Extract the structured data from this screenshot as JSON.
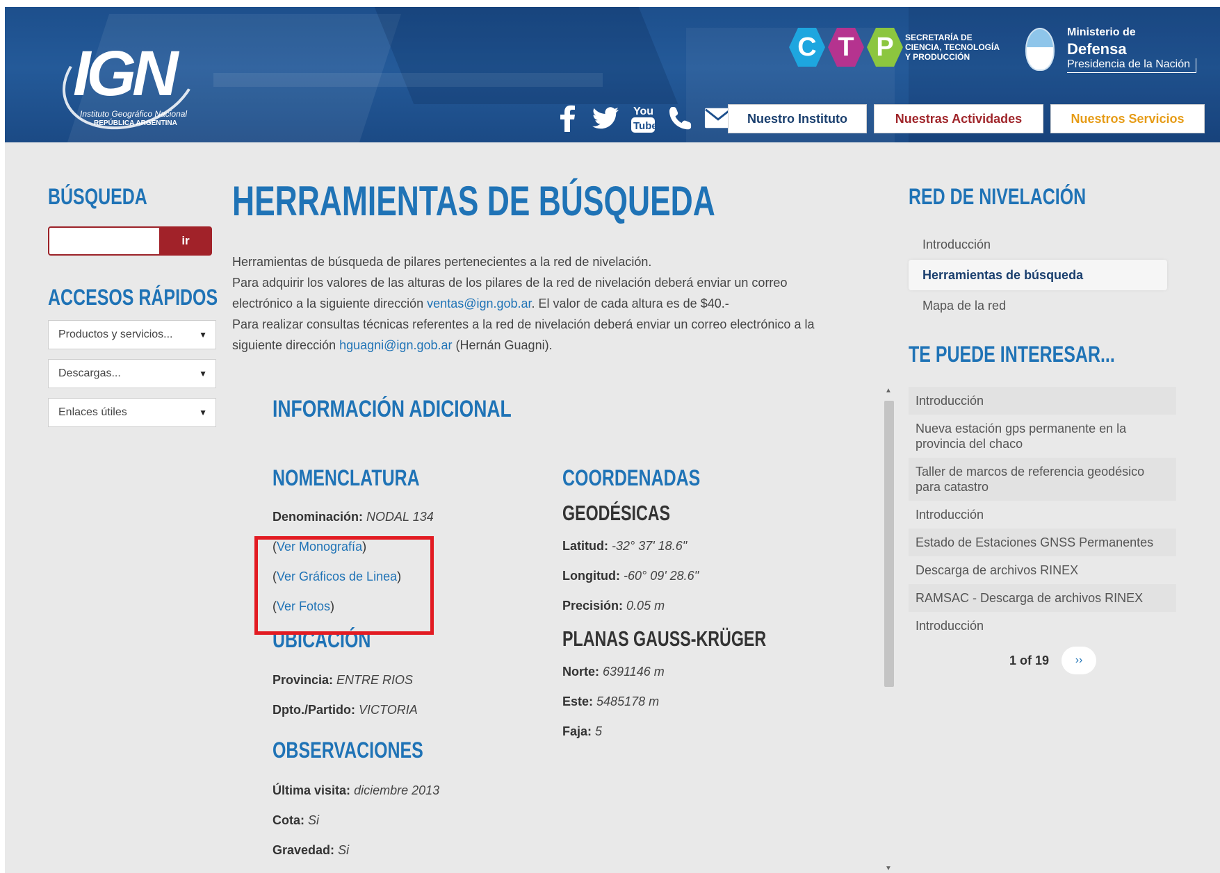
{
  "header": {
    "logo": {
      "word": "IGN",
      "sub1": "Instituto Geográfico Nacional",
      "sub2": "REPÚBLICA ARGENTINA"
    },
    "ctp": {
      "letters": [
        "C",
        "T",
        "P"
      ],
      "text_lines": [
        "SECRETARÍA DE",
        "CIENCIA, TECNOLOGÍA",
        "Y PRODUCCIÓN"
      ]
    },
    "ministerio": {
      "line1": "Ministerio de",
      "line2": "Defensa",
      "line3": "Presidencia de la Nación"
    },
    "social_icons": [
      "facebook-icon",
      "twitter-icon",
      "youtube-icon",
      "phone-icon",
      "mail-icon"
    ],
    "nav": {
      "instituto": "Nuestro Instituto",
      "actividades": "Nuestras Actividades",
      "servicios": "Nuestros Servicios"
    }
  },
  "left": {
    "busqueda_title": "BÚSQUEDA",
    "search_placeholder": "",
    "search_button": "ir",
    "accesos_title": "ACCESOS RÁPIDOS",
    "dropdowns": [
      "Productos y servicios...",
      "Descargas...",
      "Enlaces útiles"
    ]
  },
  "main": {
    "title": "HERRAMIENTAS DE BÚSQUEDA",
    "intro": {
      "line1": "Herramientas de búsqueda de pilares pertenecientes a la red de nivelación.",
      "line2": "Para adquirir los valores de las alturas de los pilares de la red de nivelación deberá enviar un correo",
      "line3_pre": "electrónico a la siguiente dirección ",
      "line3_link": "ventas@ign.gob.ar",
      "line3_post": ". El valor de cada altura es de $40.-",
      "line4": "Para realizar consultas técnicas referentes a la red de nivelación deberá enviar un correo electrónico a la",
      "line5_pre": "siguiente dirección ",
      "line5_link": "hguagni@ign.gob.ar",
      "line5_post": " (Hernán Guagni)."
    },
    "info_title": "INFORMACIÓN ADICIONAL",
    "nomenclatura": {
      "title": "NOMENCLATURA",
      "denominacion_label": "Denominación:",
      "denominacion_value": "NODAL 134",
      "links": [
        "Ver Monografía",
        "Ver Gráficos de Linea",
        "Ver Fotos"
      ]
    },
    "ubicacion": {
      "title": "UBICACIÓN",
      "provincia_label": "Provincia:",
      "provincia_value": "ENTRE RIOS",
      "dpto_label": "Dpto./Partido:",
      "dpto_value": "VICTORIA"
    },
    "observaciones": {
      "title": "OBSERVACIONES",
      "visita_label": "Última visita:",
      "visita_value": "diciembre 2013",
      "cota_label": "Cota:",
      "cota_value": "Si",
      "gravedad_label": "Gravedad:",
      "gravedad_value": "Si"
    },
    "coordenadas": {
      "title": "COORDENADAS",
      "geodesicas_title": "GEODÉSICAS",
      "latitud_label": "Latitud:",
      "latitud_value": "-32° 37' 18.6\"",
      "longitud_label": "Longitud:",
      "longitud_value": "-60° 09' 28.6\"",
      "precision_label": "Precisión:",
      "precision_value": "0.05 m",
      "planas_title": "PLANAS GAUSS-KRÜGER",
      "norte_label": "Norte:",
      "norte_value": "6391146 m",
      "este_label": "Este:",
      "este_value": "5485178 m",
      "faja_label": "Faja:",
      "faja_value": "5"
    }
  },
  "right": {
    "red_title": "RED DE NIVELACIÓN",
    "menu": [
      "Introducción",
      "Herramientas de búsqueda",
      "Mapa de la red"
    ],
    "interes_title": "TE PUEDE INTERESAR...",
    "interes_items": [
      "Introducción",
      "Nueva estación gps permanente en la provincia del chaco",
      "Taller de marcos de referencia geodésico para catastro",
      "Introducción",
      "Estado de Estaciones GNSS Permanentes",
      "Descarga de archivos RINEX",
      "RAMSAC - Descarga de archivos RINEX",
      "Introducción"
    ],
    "pager_text": "1 of 19",
    "pager_next": "››"
  },
  "colors": {
    "brand_blue": "#1f73b6",
    "header_blue": "#1d4f8c",
    "search_red": "#a12229",
    "highlight_red": "#e21b22",
    "servicios_orange": "#e69c17"
  }
}
